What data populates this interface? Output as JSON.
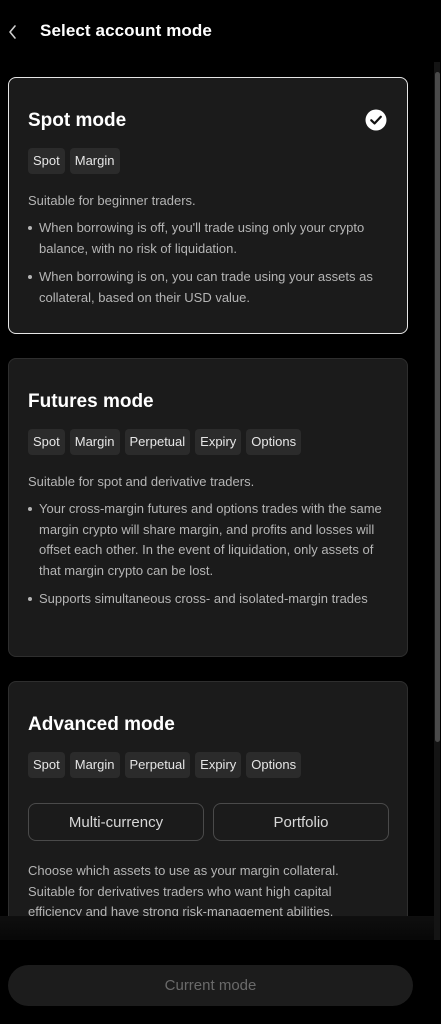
{
  "header": {
    "title": "Select account mode"
  },
  "spot": {
    "title": "Spot mode",
    "tags": [
      "Spot",
      "Margin"
    ],
    "description": "Suitable for beginner traders.",
    "bullets": [
      "When borrowing is off, you'll trade using only your crypto balance, with no risk of liquidation.",
      "When borrowing is on, you can trade using your assets as collateral, based on their USD value."
    ]
  },
  "futures": {
    "title": "Futures mode",
    "tags": [
      "Spot",
      "Margin",
      "Perpetual",
      "Expiry",
      "Options"
    ],
    "description": "Suitable for spot and derivative traders.",
    "bullets": [
      "Your cross-margin futures and options trades with the same margin crypto will share margin, and profits and losses will offset each other. In the event of liquidation, only assets of that margin crypto can be lost.",
      "Supports simultaneous cross- and isolated-margin trades"
    ]
  },
  "advanced": {
    "title": "Advanced mode",
    "tags": [
      "Spot",
      "Margin",
      "Perpetual",
      "Expiry",
      "Options"
    ],
    "sub_tabs": [
      "Multi-currency",
      "Portfolio"
    ],
    "description": "Choose which assets to use as your margin collateral. Suitable for derivatives traders who want high capital efficiency and have strong risk-management abilities."
  },
  "footer": {
    "button_label": "Current mode"
  }
}
